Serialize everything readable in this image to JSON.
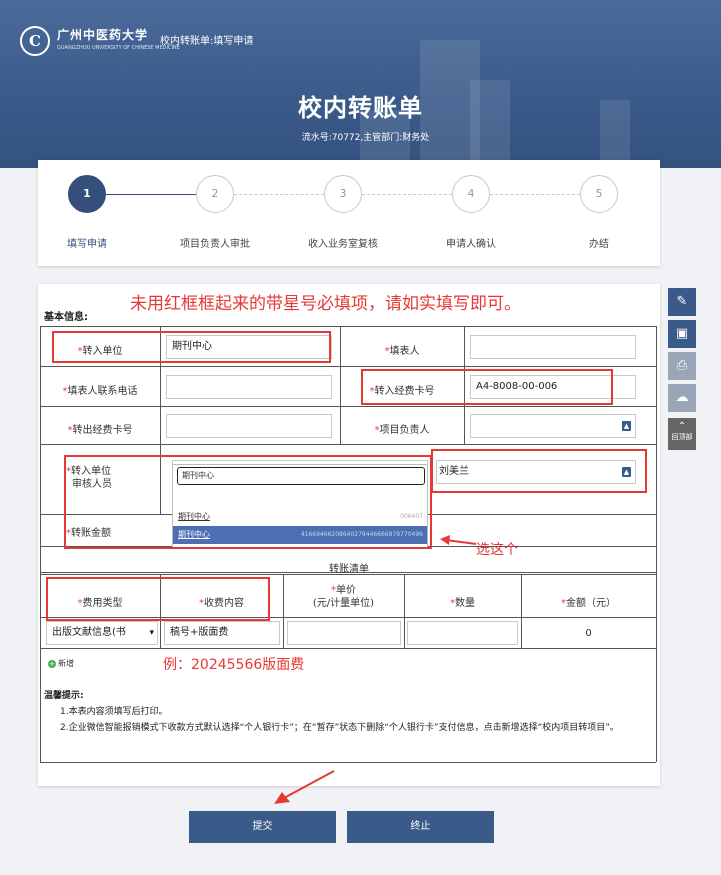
{
  "header": {
    "logo_text": "C",
    "university_name": "广州中医药大学",
    "university_en": "GUANGZHOU UNIVERSITY OF CHINESE MEDICINE",
    "app_title": "校内转账单:填写申请",
    "main_title": "校内转账单",
    "serial": "流水号:70772,主管部门:财务处"
  },
  "steps": [
    {
      "num": "1",
      "label": "填写申请"
    },
    {
      "num": "2",
      "label": "项目负责人审批"
    },
    {
      "num": "3",
      "label": "收入业务室复核"
    },
    {
      "num": "4",
      "label": "申请人确认"
    },
    {
      "num": "5",
      "label": "办结"
    }
  ],
  "form": {
    "section_basic": "基本信息:",
    "annotation_top": "未用红框框起来的带星号必填项，请如实填写即可。",
    "star": "*",
    "fields": {
      "transfer_in_unit": {
        "label": "转入单位",
        "value": "期刊中心"
      },
      "filler": {
        "label": "填表人",
        "value": ""
      },
      "filler_phone": {
        "label": "填表人联系电话",
        "value": ""
      },
      "in_card": {
        "label": "转入经费卡号",
        "value": "A4-8008-00-006"
      },
      "out_card": {
        "label": "转出经费卡号",
        "value": ""
      },
      "project_leader": {
        "label": "项目负责人",
        "value": ""
      },
      "auditor_line1": "转入单位",
      "auditor_line2": "审核人员",
      "auditor_value": "刘美兰",
      "amount": {
        "label": "转账金额",
        "value": ""
      }
    },
    "dropdown": {
      "typed": "期刊中心",
      "items": [
        {
          "text": "期刊中心",
          "sub": "006407"
        },
        {
          "text": "期刊中心",
          "sub": "41669466208640279446666979770496"
        }
      ]
    },
    "annotation_pick": "选这个",
    "transfer_list_title": "转账清单",
    "list_headers": {
      "fee_type": "费用类型",
      "content": "收费内容",
      "price_line1": "单价",
      "price_line2": "(元/计量单位)",
      "qty": "数量",
      "amount": "金额（元）"
    },
    "list_row": {
      "fee_type": "出版文献信息(书",
      "content": "稿号+版面费",
      "price": "",
      "qty": "",
      "amount": "0"
    },
    "add_label": "新增",
    "annotation_example": "例：20245566版面费",
    "tips_title": "温馨提示:",
    "tip1": "1.本表内容须填写后打印。",
    "tip2": "2.企业微信智能报销模式下收款方式默认选择“个人银行卡”；在“暂存”状态下删除“个人银行卡”支付信息，点击新增选择“校内项目转项目”。"
  },
  "buttons": {
    "submit": "提交",
    "stop": "终止"
  },
  "toolbar": {
    "back_top": "回顶部"
  },
  "colors": {
    "primary": "#3a5a8a",
    "annotation": "#e53935"
  }
}
